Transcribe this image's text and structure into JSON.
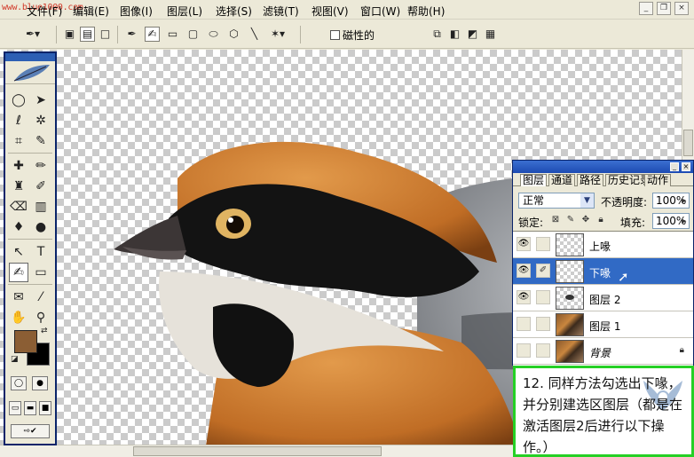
{
  "watermark_url": "www.blue1000.com",
  "menubar": {
    "items": [
      {
        "label": "文件(F)"
      },
      {
        "label": "编辑(E)"
      },
      {
        "label": "图像(I)"
      },
      {
        "label": "图层(L)"
      },
      {
        "label": "选择(S)"
      },
      {
        "label": "滤镜(T)"
      },
      {
        "label": "视图(V)"
      },
      {
        "label": "窗口(W)"
      },
      {
        "label": "帮助(H)"
      }
    ],
    "window_buttons": {
      "minimize": "_",
      "restore": "❐",
      "close": "×"
    }
  },
  "options_bar": {
    "magnetic_label": "磁性的",
    "magnetic_checked": false
  },
  "layers_panel": {
    "tabs": [
      "图层",
      "通道",
      "路径",
      "历史记录",
      "动作"
    ],
    "active_tab": "图层",
    "blend_mode": "正常",
    "opacity_label": "不透明度:",
    "opacity_value": "100%",
    "lock_label": "锁定:",
    "fill_label": "填充:",
    "fill_value": "100%",
    "layers": [
      {
        "name": "上喙",
        "visible": true,
        "selected": false
      },
      {
        "name": "下喙",
        "visible": true,
        "selected": true
      },
      {
        "name": "图层 2",
        "visible": true,
        "selected": false
      },
      {
        "name": "图层 1",
        "visible": false,
        "selected": false
      },
      {
        "name": "背景",
        "visible": false,
        "selected": false,
        "locked": true
      }
    ]
  },
  "instruction": {
    "text": "12. 同样方法勾选出下喙，并分别建选区图层（都是在激活图层2后进行以下操作。）"
  },
  "colors": {
    "foreground": "#8b5e34",
    "background": "#000000",
    "note_border": "#25d025",
    "selection": "#316ac5"
  }
}
